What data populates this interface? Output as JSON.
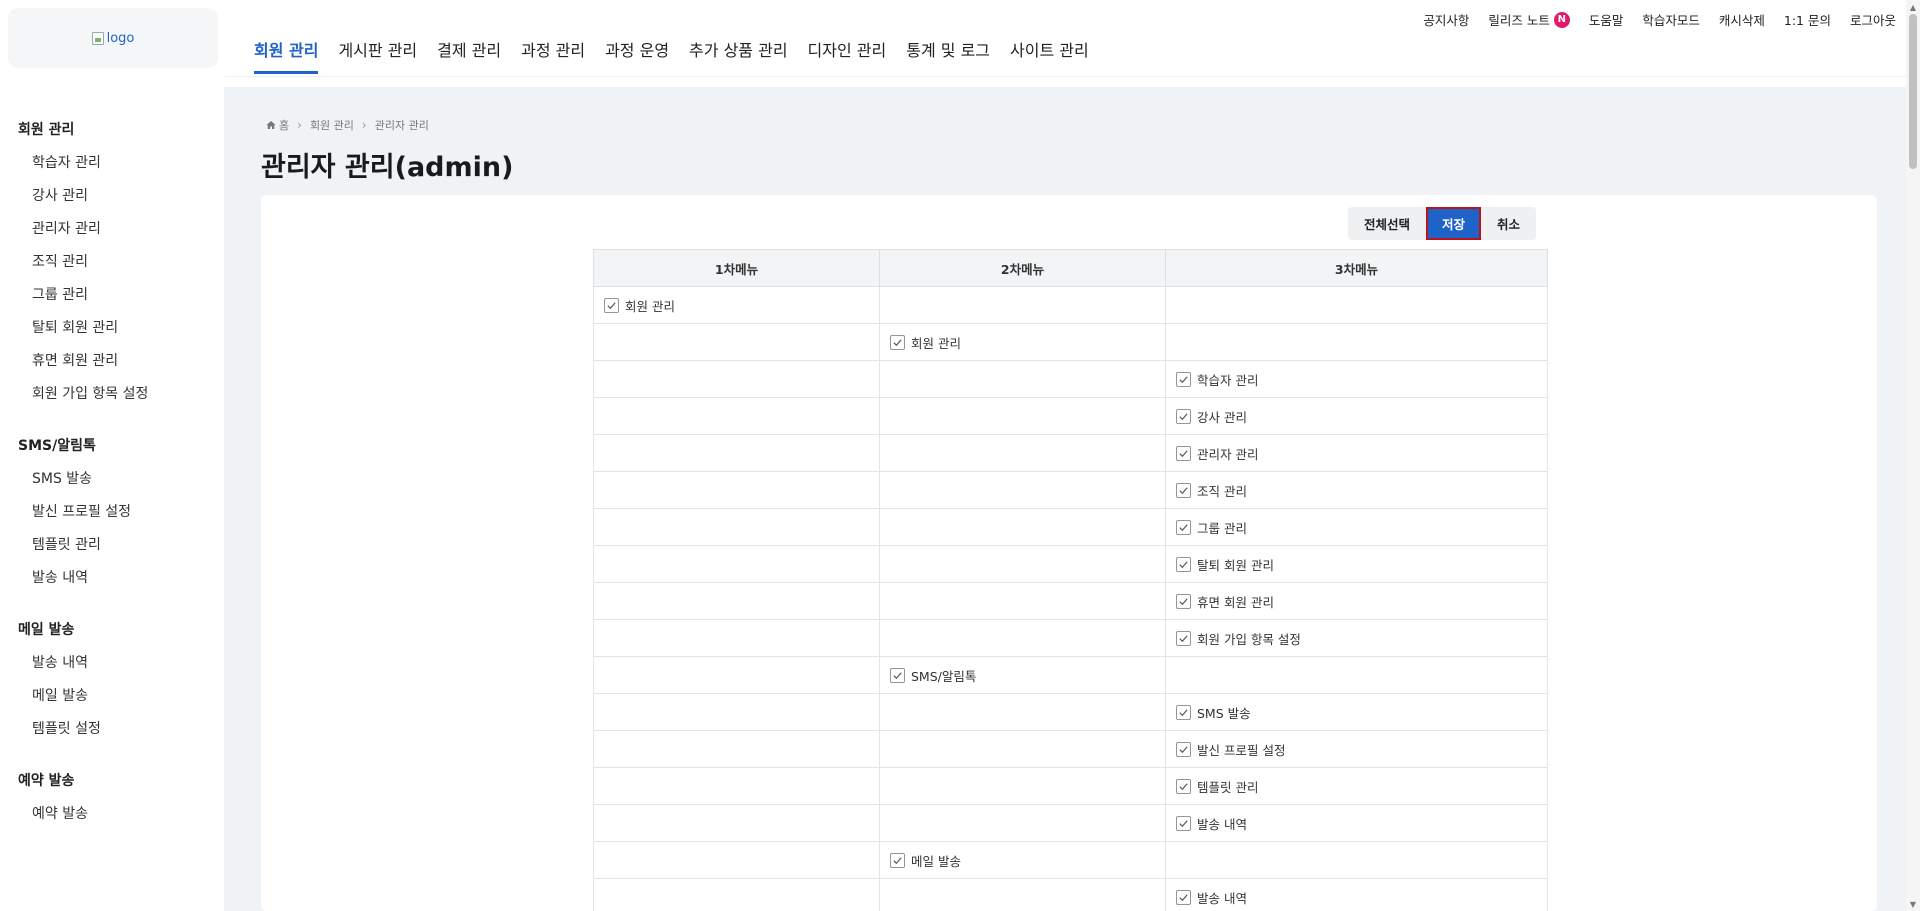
{
  "header": {
    "logo_alt": "logo",
    "gnb": [
      {
        "label": "회원 관리",
        "active": true
      },
      {
        "label": "게시판 관리"
      },
      {
        "label": "결제 관리"
      },
      {
        "label": "과정 관리"
      },
      {
        "label": "과정 운영"
      },
      {
        "label": "추가 상품 관리"
      },
      {
        "label": "디자인 관리"
      },
      {
        "label": "통계 및 로그"
      },
      {
        "label": "사이트 관리"
      }
    ],
    "util": {
      "notice": "공지사항",
      "release_notes": "릴리즈 노트",
      "release_badge": "N",
      "help": "도움말",
      "learner_mode": "학습자모드",
      "clear_cache": "캐시삭제",
      "inquiry": "1:1 문의",
      "logout": "로그아웃"
    }
  },
  "sidebar": {
    "groups": [
      {
        "title": "회원 관리",
        "items": [
          "학습자 관리",
          "강사 관리",
          "관리자 관리",
          "조직 관리",
          "그룹 관리",
          "탈퇴 회원 관리",
          "휴면 회원 관리",
          "회원 가입 항목 설정"
        ]
      },
      {
        "title": "SMS/알림톡",
        "items": [
          "SMS 발송",
          "발신 프로필 설정",
          "템플릿 관리",
          "발송 내역"
        ]
      },
      {
        "title": "메일 발송",
        "items": [
          "발송 내역",
          "메일 발송",
          "템플릿 설정"
        ]
      },
      {
        "title": "예약 발송",
        "items": [
          "예약 발송"
        ]
      }
    ]
  },
  "breadcrumb": {
    "home": "홈",
    "level1": "회원 관리",
    "level2": "관리자 관리"
  },
  "page_title": "관리자 관리(admin)",
  "buttons": {
    "select_all": "전체선택",
    "save": "저장",
    "cancel": "취소"
  },
  "table": {
    "headers": [
      "1차메뉴",
      "2차메뉴",
      "3차메뉴"
    ],
    "rows": [
      {
        "level": 1,
        "label": "회원 관리",
        "checked": true
      },
      {
        "level": 2,
        "label": "회원 관리",
        "checked": true
      },
      {
        "level": 3,
        "label": "학습자 관리",
        "checked": true
      },
      {
        "level": 3,
        "label": "강사 관리",
        "checked": true
      },
      {
        "level": 3,
        "label": "관리자 관리",
        "checked": true
      },
      {
        "level": 3,
        "label": "조직 관리",
        "checked": true
      },
      {
        "level": 3,
        "label": "그룹 관리",
        "checked": true
      },
      {
        "level": 3,
        "label": "탈퇴 회원 관리",
        "checked": true
      },
      {
        "level": 3,
        "label": "휴면 회원 관리",
        "checked": true
      },
      {
        "level": 3,
        "label": "회원 가입 항목 설정",
        "checked": true
      },
      {
        "level": 2,
        "label": "SMS/알림톡",
        "checked": true
      },
      {
        "level": 3,
        "label": "SMS 발송",
        "checked": true
      },
      {
        "level": 3,
        "label": "발신 프로필 설정",
        "checked": true
      },
      {
        "level": 3,
        "label": "템플릿 관리",
        "checked": true
      },
      {
        "level": 3,
        "label": "발송 내역",
        "checked": true
      },
      {
        "level": 2,
        "label": "메일 발송",
        "checked": true
      },
      {
        "level": 3,
        "label": "발송 내역",
        "checked": true
      }
    ]
  },
  "colors": {
    "accent": "#1f62c8",
    "badge": "#e0196a",
    "highlight_border": "#b8141c",
    "content_bg": "#f0f3f5"
  }
}
